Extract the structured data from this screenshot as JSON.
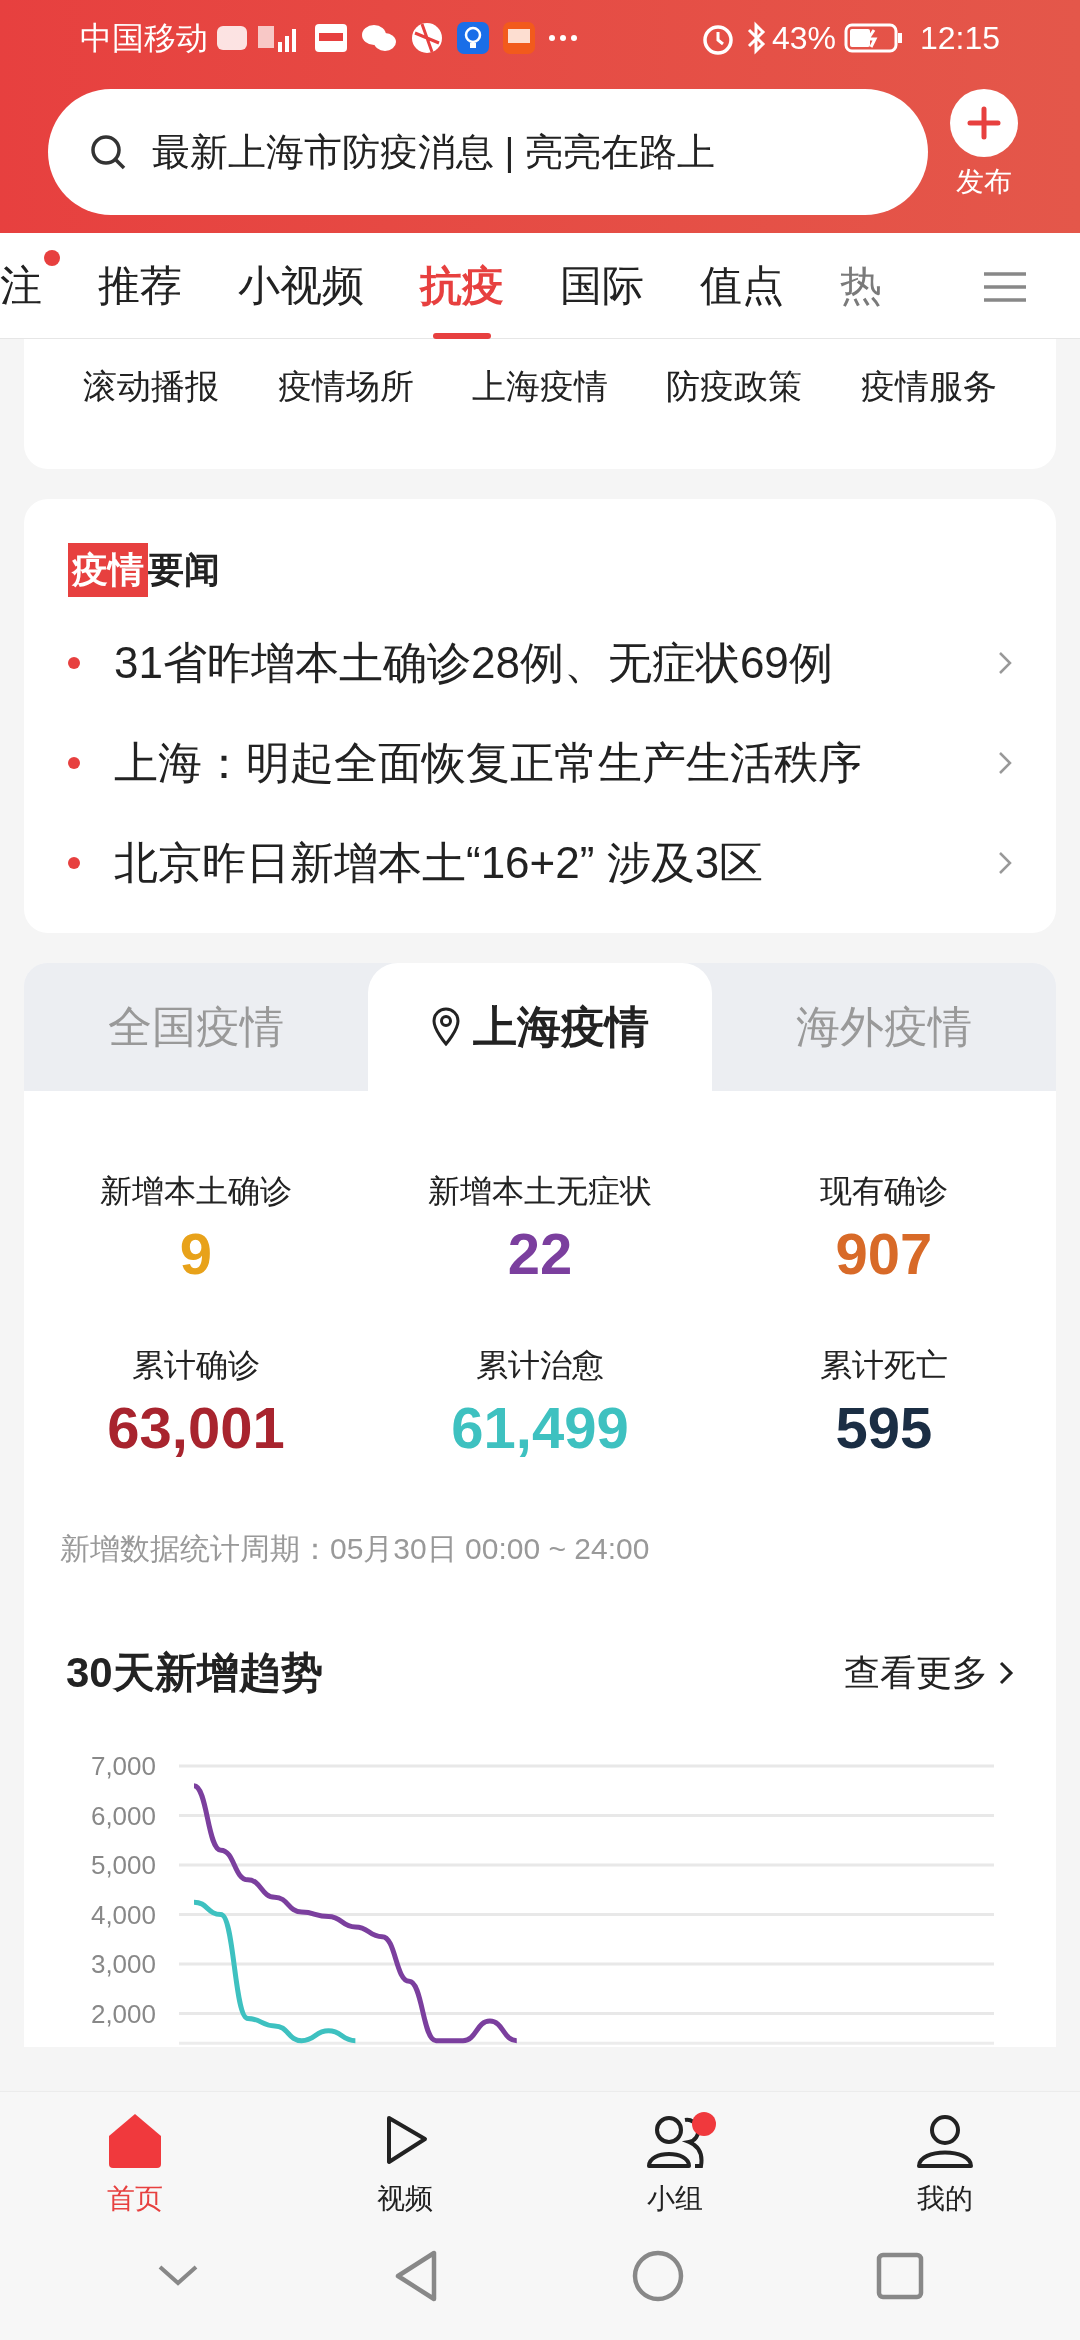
{
  "status_bar": {
    "carrier": "中国移动",
    "battery": "43%",
    "time": "12:15"
  },
  "search": {
    "placeholder": "最新上海市防疫消息 | 亮亮在路上"
  },
  "publish_button": {
    "label": "发布"
  },
  "channel_tabs": [
    {
      "label": "注",
      "selected": false,
      "dot": true
    },
    {
      "label": "推荐",
      "selected": false,
      "dot": false
    },
    {
      "label": "小视频",
      "selected": false,
      "dot": false
    },
    {
      "label": "抗疫",
      "selected": true,
      "dot": false
    },
    {
      "label": "国际",
      "selected": false,
      "dot": false
    },
    {
      "label": "值点",
      "selected": false,
      "dot": false
    },
    {
      "label": "热",
      "selected": false,
      "dot": false
    }
  ],
  "sub_tabs": [
    "滚动播报",
    "疫情场所",
    "上海疫情",
    "防疫政策",
    "疫情服务"
  ],
  "news": {
    "tag": "疫情",
    "title": "要闻",
    "items": [
      "31省昨增本土确诊28例、无症状69例",
      "上海：明起全面恢复正常生产生活秩序",
      "北京昨日新增本土“16+2” 涉及3区"
    ]
  },
  "region_tabs": [
    {
      "label": "全国疫情",
      "selected": false
    },
    {
      "label": "上海疫情",
      "selected": true
    },
    {
      "label": "海外疫情",
      "selected": false
    }
  ],
  "stats": [
    {
      "label": "新增本土确诊",
      "value": "9",
      "color": "#e8a21a"
    },
    {
      "label": "新增本土无症状",
      "value": "22",
      "color": "#7b3f9e"
    },
    {
      "label": "现有确诊",
      "value": "907",
      "color": "#d86a28"
    },
    {
      "label": "累计确诊",
      "value": "63,001",
      "color": "#a8242e"
    },
    {
      "label": "累计治愈",
      "value": "61,499",
      "color": "#3ec1c0"
    },
    {
      "label": "累计死亡",
      "value": "595",
      "color": "#1b2e44"
    }
  ],
  "note": "新增数据统计周期：05月30日 00:00 ~ 24:00",
  "trend": {
    "title": "30天新增趋势",
    "more": "查看更多",
    "chart_data": {
      "type": "line",
      "grid": true,
      "ylim": [
        1400,
        7000
      ],
      "yticks": [
        {
          "value": 2000,
          "label": "2,000"
        },
        {
          "value": 3000,
          "label": "3,000"
        },
        {
          "value": 4000,
          "label": "4,000"
        },
        {
          "value": 5000,
          "label": "5,000"
        },
        {
          "value": 6000,
          "label": "6,000"
        },
        {
          "value": 7000,
          "label": "7,000"
        }
      ],
      "series": [
        {
          "color": "#7b3f9e",
          "values": [
            6600,
            5300,
            4700,
            4350,
            4050,
            3960,
            3750,
            3550,
            2650,
            1450,
            1450,
            1850,
            1450,
            null,
            null,
            null,
            null,
            null,
            null,
            null,
            null,
            null,
            null,
            null,
            null,
            null,
            null,
            null,
            null,
            null
          ]
        },
        {
          "color": "#3ec1c0",
          "values": [
            4250,
            4000,
            1900,
            1750,
            1450,
            1650,
            1450,
            null,
            null,
            null,
            null,
            null,
            null,
            null,
            null,
            null,
            null,
            null,
            null,
            null,
            null,
            null,
            null,
            null,
            null,
            null,
            null,
            null,
            null,
            null
          ]
        }
      ]
    }
  },
  "bottom_nav": [
    {
      "label": "首页",
      "selected": true,
      "dot": false,
      "kind": "home"
    },
    {
      "label": "视频",
      "selected": false,
      "dot": false,
      "kind": "video"
    },
    {
      "label": "小组",
      "selected": false,
      "dot": true,
      "kind": "group"
    },
    {
      "label": "我的",
      "selected": false,
      "dot": false,
      "kind": "me"
    }
  ]
}
